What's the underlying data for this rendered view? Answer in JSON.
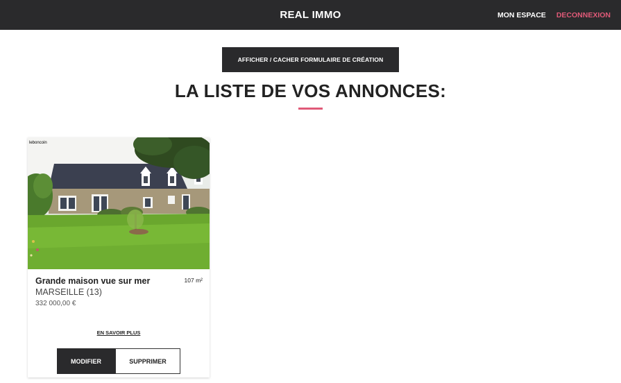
{
  "navbar": {
    "brand": "REAL IMMO",
    "my_space": "MON ESPACE",
    "logout": "DECONNEXION"
  },
  "toggle_button": "AFFICHER / CACHER FORMULAIRE DE CRÉATION",
  "page_title": "LA LISTE DE VOS ANNONCES:",
  "listings": [
    {
      "photo_watermark": "leboncoin",
      "title": "Grande maison vue sur mer",
      "area": "107 m²",
      "city": "MARSEILLE (13)",
      "price": "332 000,00 €",
      "more_link": "EN SAVOIR PLUS",
      "edit_label": "MODIFIER",
      "delete_label": "SUPPRIMER"
    }
  ],
  "colors": {
    "navbar_bg": "#2a2a2c",
    "accent": "#e05a78",
    "text": "#222222"
  }
}
